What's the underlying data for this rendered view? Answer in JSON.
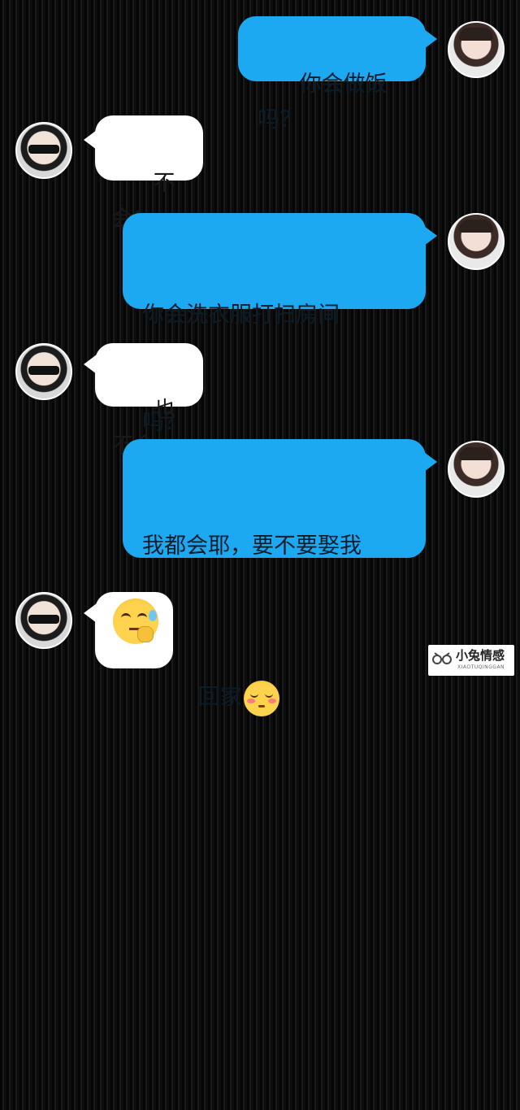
{
  "messages": [
    {
      "sender": "her",
      "text": "你会做饭吗？"
    },
    {
      "sender": "him",
      "text": "不会!"
    },
    {
      "sender": "her",
      "line1": "你会洗衣服打扫房间",
      "line2": "吗？"
    },
    {
      "sender": "him",
      "text": "也不会"
    },
    {
      "sender": "her",
      "line1": "我都会耶，要不要娶我",
      "line2": "回家",
      "emoji": "blush-emoji"
    },
    {
      "sender": "him",
      "emoji": "sweat-hand-over-mouth-emoji"
    }
  ],
  "watermark": {
    "brand": "小兔情感",
    "sub": "XIAOTUQINGGAN",
    "icon": "glasses-logo-icon"
  },
  "colors": {
    "outgoing_bubble": "#1ca9f2",
    "incoming_bubble": "#ffffff",
    "background": "#0b0b0b"
  }
}
